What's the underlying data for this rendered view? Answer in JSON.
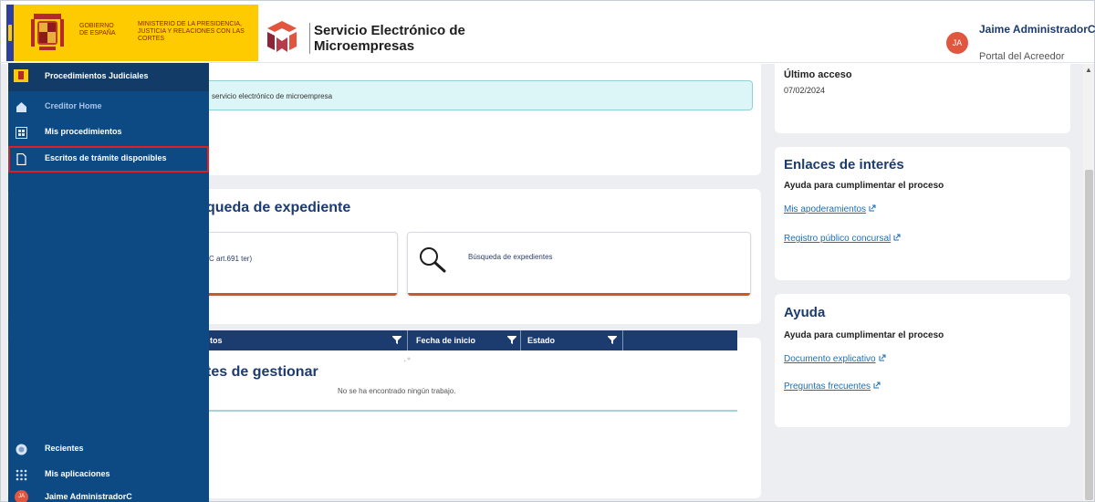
{
  "header": {
    "gov_line1": "GOBIERNO DE ESPAÑA",
    "gov_line2": "MINISTERIO DE LA PRESIDENCIA, JUSTICIA Y RELACIONES CON LAS CORTES",
    "app_title": "Servicio Electrónico de Microempresas",
    "avatar_initials": "JA",
    "user_name": "Jaime AdministradorC",
    "user_role": "Portal del Acreedor"
  },
  "sidebar": {
    "top_label": "Procedimientos Judiciales",
    "items": [
      {
        "label": "Creditor Home",
        "icon": "home-icon"
      },
      {
        "label": "Mis procedimientos",
        "icon": "grid-icon"
      },
      {
        "label": "Escritos de trámite disponibles",
        "icon": "document-icon"
      }
    ],
    "bottom_items": [
      {
        "label": "Recientes",
        "icon": "recent-icon"
      },
      {
        "label": "Mis aplicaciones",
        "icon": "apps-icon"
      },
      {
        "label": "Jaime AdministradorC",
        "icon": "avatar-icon"
      }
    ],
    "bottom_avatar_initials": "JA"
  },
  "main": {
    "notice_text": "servicio electrónico de microempresa",
    "search_title": "queda de expediente",
    "tile_left_text": "C art.691 ter)",
    "tile_right_text": "Búsqueda de expedientes",
    "pending_title": "tes de gestionar",
    "table": {
      "columns": [
        "tos",
        "Fecha de inicio",
        "Estado"
      ],
      "empty_text": "No se ha encontrado ningún trabajo."
    }
  },
  "right": {
    "last_access_label": "Último acceso",
    "last_access_value": "07/02/2024",
    "links_title": "Enlaces de interés",
    "links_subtitle": "Ayuda para cumplimentar el proceso",
    "links": [
      "Mis apoderamientos",
      "Registro público concursal"
    ],
    "help_title": "Ayuda",
    "help_subtitle": "Ayuda para cumplimentar el proceso",
    "help_links": [
      "Documento explicativo",
      "Preguntas frecuentes"
    ]
  },
  "colors": {
    "sidebar": "#0d4a84",
    "brand_navy": "#1c3b6e",
    "accent_orange": "#c9582b",
    "highlight_red": "#e01e26",
    "gov_yellow": "#fecb00"
  }
}
